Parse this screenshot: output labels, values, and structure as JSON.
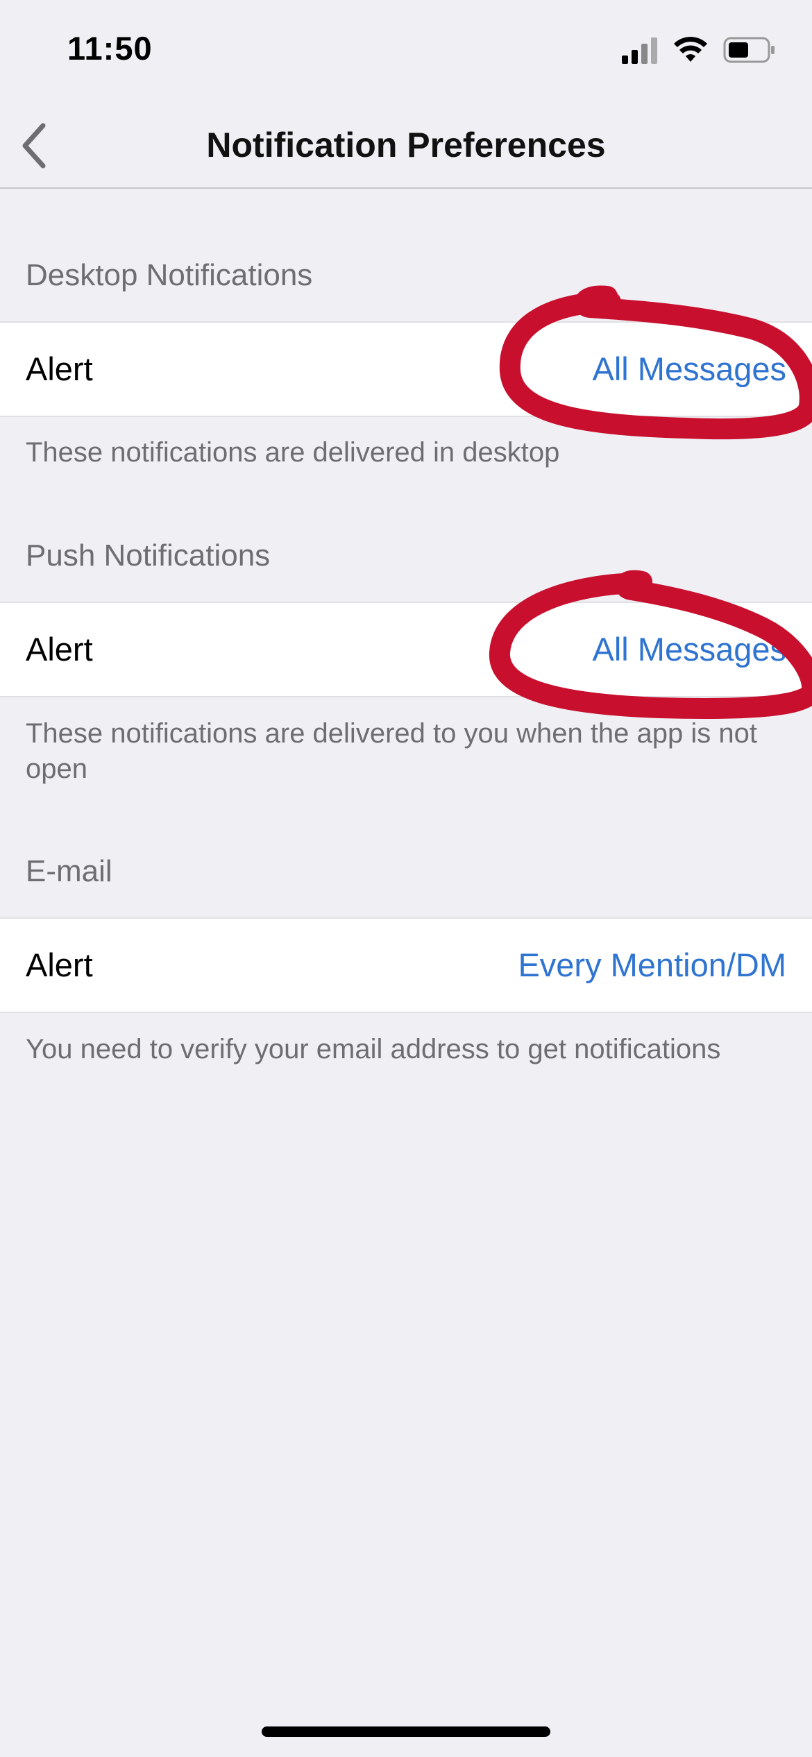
{
  "status_bar": {
    "time": "11:50",
    "icons": [
      "cellular-signal-icon",
      "wifi-icon",
      "battery-icon"
    ]
  },
  "nav": {
    "back_icon": "chevron-left-icon",
    "title": "Notification Preferences"
  },
  "sections": [
    {
      "header": "Desktop Notifications",
      "row_label": "Alert",
      "row_value": "All Messages",
      "footer": "These notifications are delivered in desktop"
    },
    {
      "header": "Push Notifications",
      "row_label": "Alert",
      "row_value": "All Messages",
      "footer": "These notifications are delivered to you when the app is not open"
    },
    {
      "header": "E-mail",
      "row_label": "Alert",
      "row_value": "Every Mention/DM",
      "footer": "You need to verify your email address to get notifications"
    }
  ],
  "colors": {
    "background": "#efeff4",
    "accent": "#2f74d0",
    "annotation": "#c8102e"
  }
}
